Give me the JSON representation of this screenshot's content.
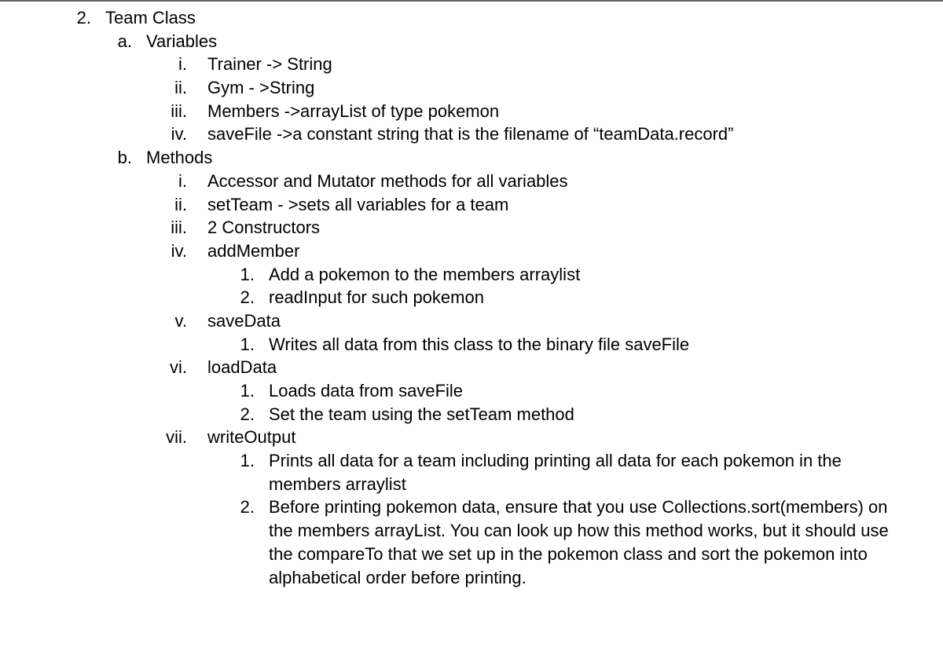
{
  "outline": {
    "l1": {
      "ord": "2.",
      "text": "Team Class",
      "children": [
        {
          "ord": "a.",
          "text": "Variables",
          "children": [
            {
              "ord": "i.",
              "text": "Trainer -> String"
            },
            {
              "ord": "ii.",
              "text": "Gym - >String"
            },
            {
              "ord": "iii.",
              "text": "Members ->arrayList of type pokemon"
            },
            {
              "ord": "iv.",
              "text": "saveFile ->a constant string that is the filename of  “teamData.record”"
            }
          ]
        },
        {
          "ord": "b.",
          "text": "Methods",
          "children": [
            {
              "ord": "i.",
              "text": "Accessor and Mutator methods for all variables"
            },
            {
              "ord": "ii.",
              "text": "setTeam - >sets all variables for a team"
            },
            {
              "ord": "iii.",
              "text": "2 Constructors"
            },
            {
              "ord": "iv.",
              "text": "addMember",
              "children": [
                {
                  "ord": "1.",
                  "text": "Add a pokemon to the members arraylist"
                },
                {
                  "ord": "2.",
                  "text": "readInput for such pokemon"
                }
              ]
            },
            {
              "ord": "v.",
              "text": "saveData",
              "children": [
                {
                  "ord": "1.",
                  "text": "Writes all data from this class to the binary file saveFile"
                }
              ]
            },
            {
              "ord": "vi.",
              "text": "loadData",
              "children": [
                {
                  "ord": "1.",
                  "text": "Loads data from saveFile"
                },
                {
                  "ord": "2.",
                  "text": "Set the team using the setTeam method"
                }
              ]
            },
            {
              "ord": "vii.",
              "text": "writeOutput",
              "children": [
                {
                  "ord": "1.",
                  "text": "Prints all data for a team including printing all data for each pokemon in the members arraylist"
                },
                {
                  "ord": "2.",
                  "text": "Before printing pokemon data, ensure that you use Collections.sort(members) on the members arrayList. You can look up how this method works, but it should use the compareTo that we set up in the pokemon class and sort the pokemon into alphabetical order before printing."
                }
              ]
            }
          ]
        }
      ]
    }
  }
}
